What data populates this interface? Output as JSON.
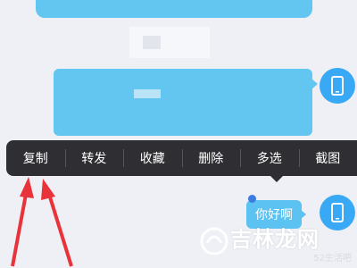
{
  "context_menu": {
    "items": [
      {
        "label": "复制"
      },
      {
        "label": "转发"
      },
      {
        "label": "收藏"
      },
      {
        "label": "删除"
      },
      {
        "label": "多选"
      },
      {
        "label": "截图"
      }
    ]
  },
  "chat": {
    "reply_message": "你好啊"
  },
  "watermark": {
    "brand": "吉林龙网",
    "sub": "52生活吧"
  },
  "colors": {
    "bubble": "#5bc2f2",
    "menu_bg": "#2f2f33",
    "avatar": "#3aa9f5",
    "arrow": "#e8333a"
  },
  "icons": [
    "phone-icon",
    "phone-icon",
    "watermark-logo-icon"
  ]
}
